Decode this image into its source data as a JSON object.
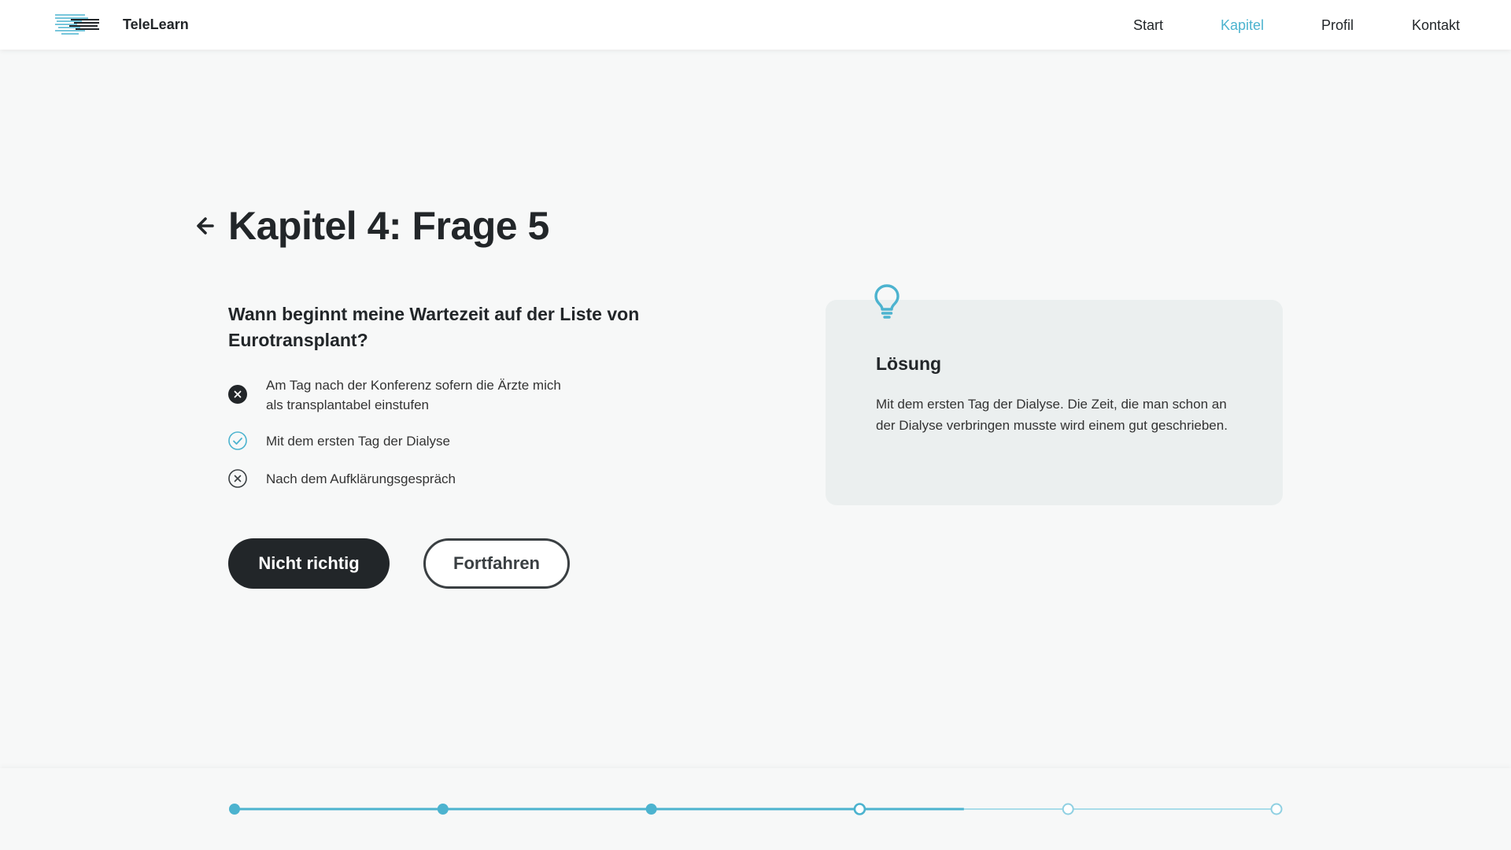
{
  "header": {
    "brand": "TeleLearn",
    "nav": [
      "Start",
      "Kapitel",
      "Profil",
      "Kontakt"
    ],
    "active_nav": "Kapitel"
  },
  "page": {
    "title": "Kapitel 4: Frage 5"
  },
  "question": {
    "text": "Wann beginnt meine Wartezeit auf der Liste von Eurotransplant?",
    "answers": [
      {
        "label": "Am Tag nach der Konferenz sofern die Ärzte mich als transplantabel einstufen",
        "state": "selected-wrong",
        "icon": "x-filled-icon"
      },
      {
        "label": "Mit dem ersten Tag der Dialyse",
        "state": "correct",
        "icon": "check-circle-icon"
      },
      {
        "label": "Nach dem Aufklärungsgespräch",
        "state": "wrong",
        "icon": "x-circle-icon"
      }
    ]
  },
  "buttons": {
    "result_label": "Nicht richtig",
    "continue_label": "Fortfahren"
  },
  "solution": {
    "icon": "lightbulb-icon",
    "title": "Lösung",
    "text": "Mit dem ersten Tag der Dialyse. Die Zeit, die man schon an der Dialyse verbringen musste wird einem gut geschrieben."
  },
  "progress": {
    "total_steps": 6,
    "current_step": 4,
    "fraction_filled": 0.7
  },
  "colors": {
    "accent": "#4cb3cf",
    "dark": "#222629",
    "card": "#ebefef"
  }
}
